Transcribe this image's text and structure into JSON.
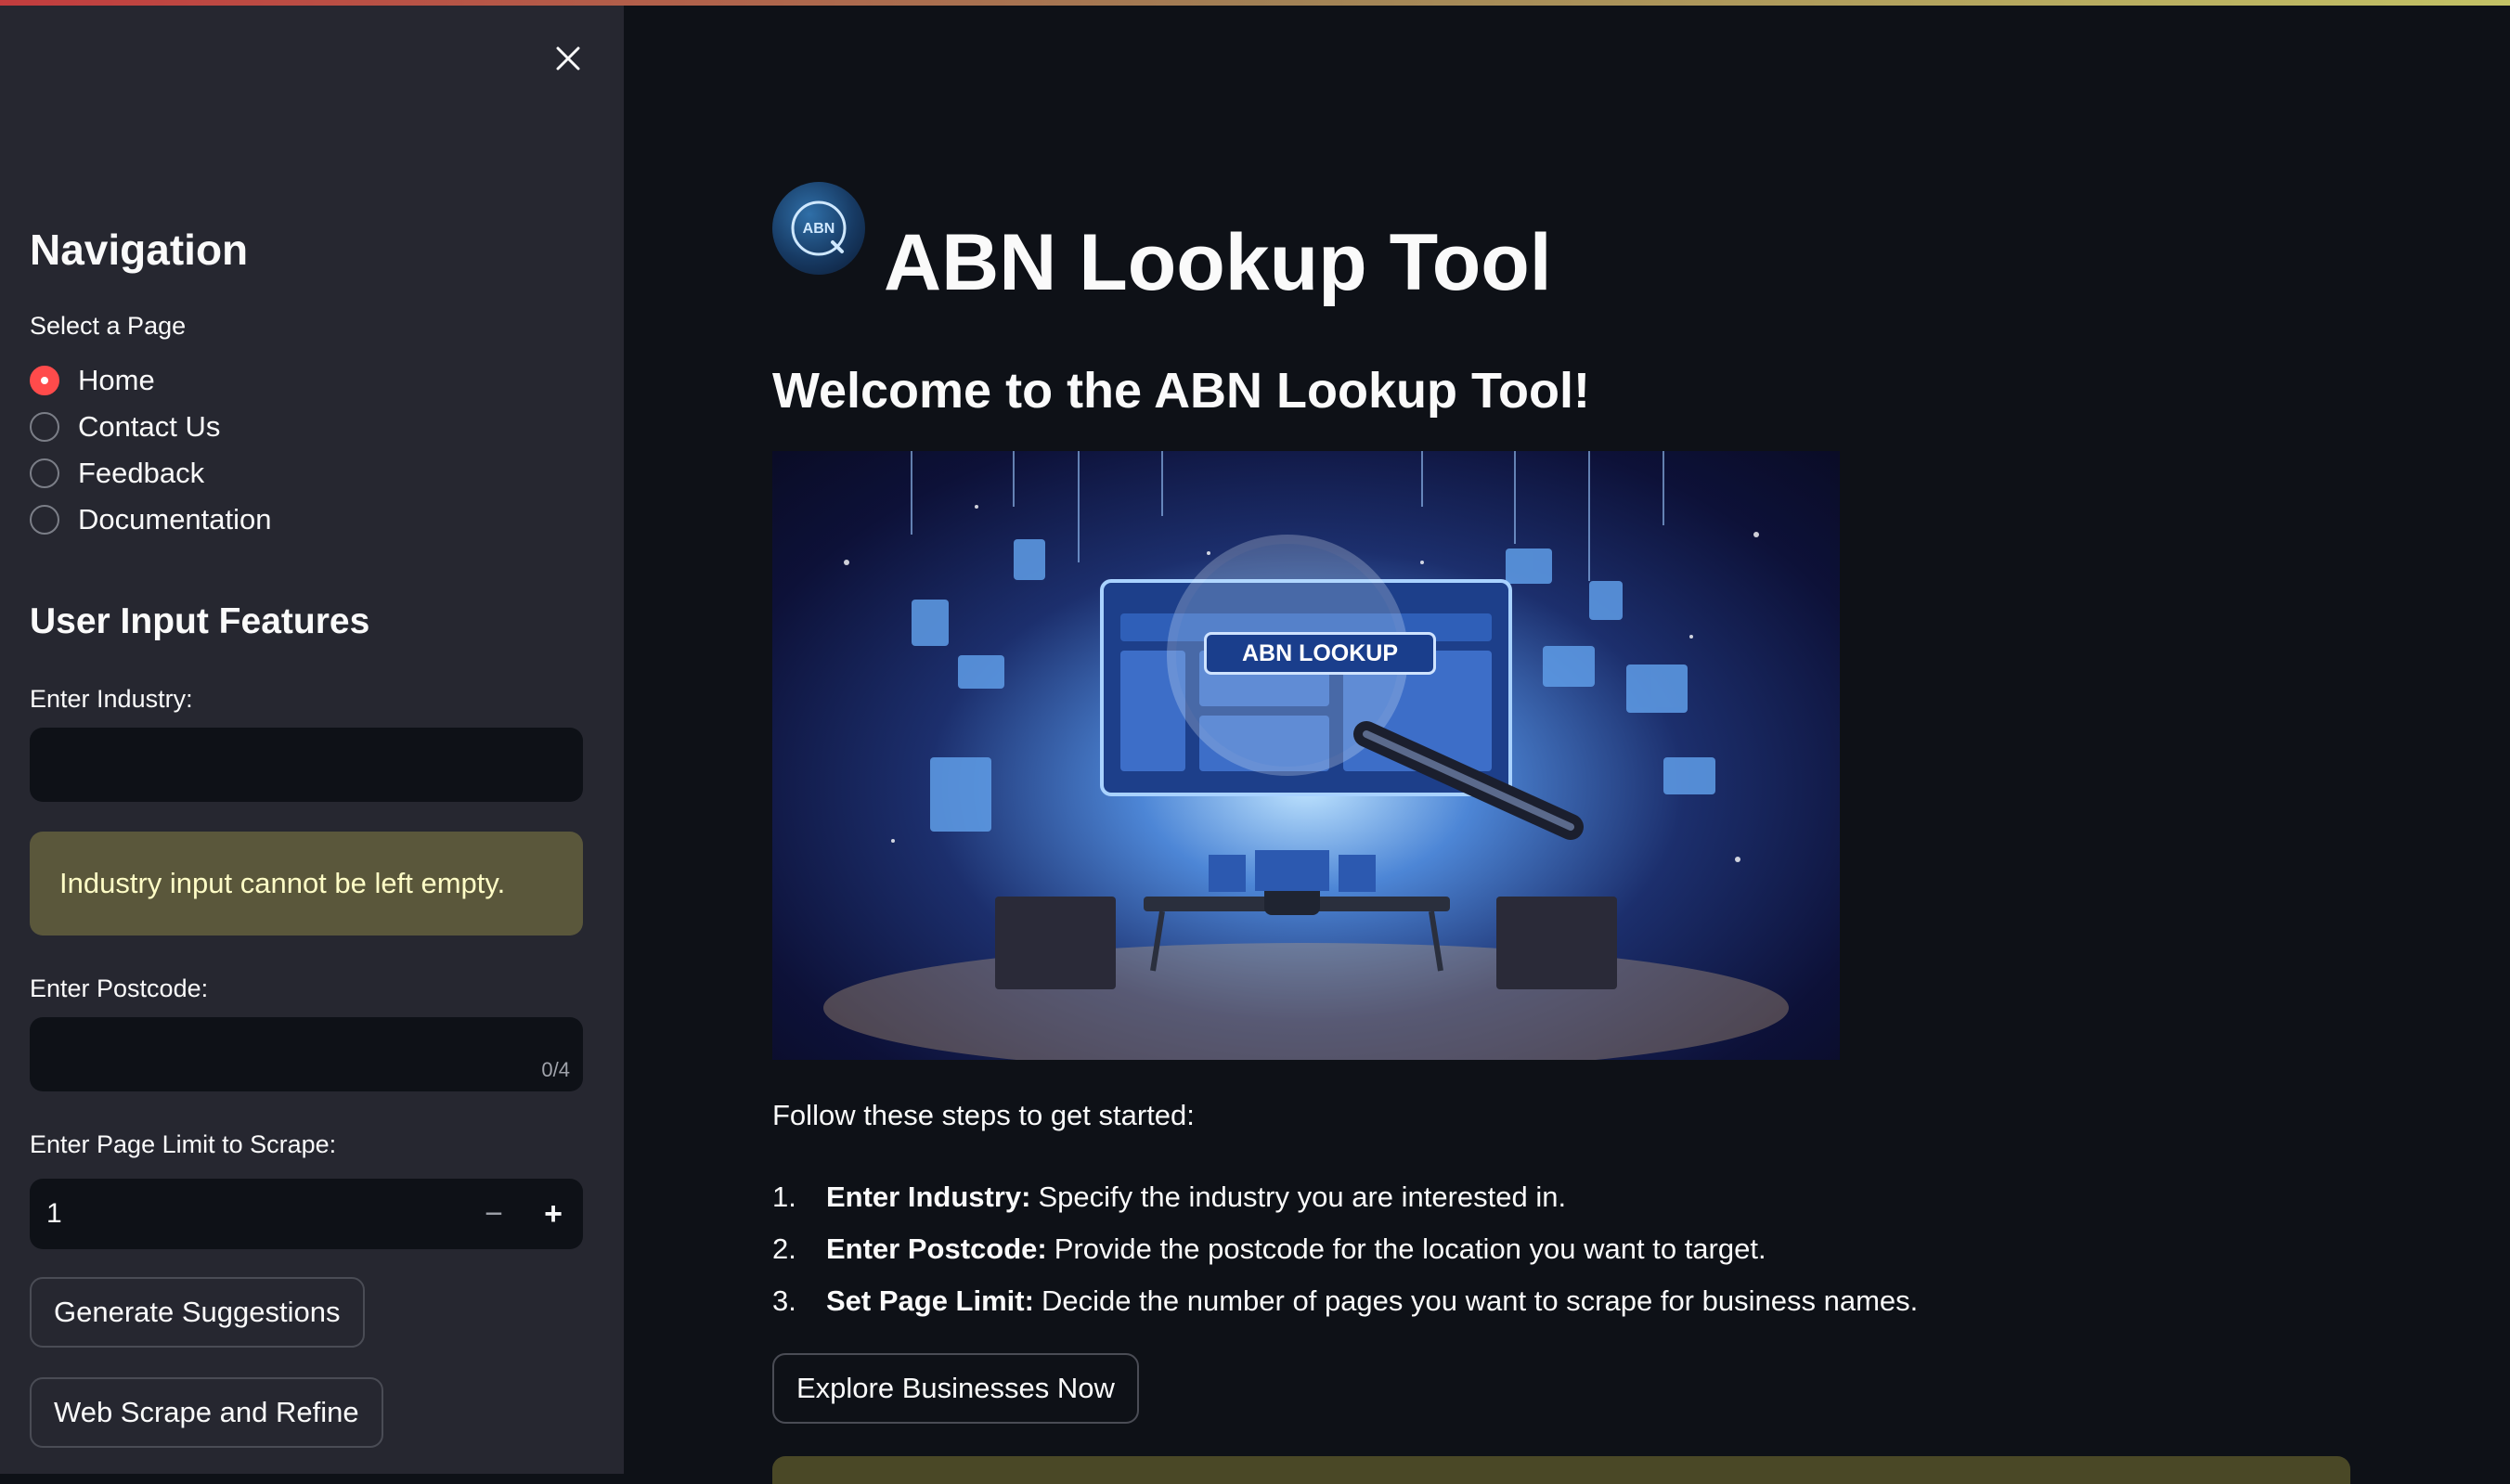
{
  "sidebar": {
    "nav_heading": "Navigation",
    "select_page_label": "Select a Page",
    "pages": [
      {
        "label": "Home",
        "selected": true
      },
      {
        "label": "Contact Us",
        "selected": false
      },
      {
        "label": "Feedback",
        "selected": false
      },
      {
        "label": "Documentation",
        "selected": false
      }
    ],
    "features_heading": "User Input Features",
    "industry_label": "Enter Industry:",
    "industry_value": "",
    "industry_warning": "Industry input cannot be left empty.",
    "postcode_label": "Enter Postcode:",
    "postcode_value": "",
    "postcode_counter": "0/4",
    "page_limit_label": "Enter Page Limit to Scrape:",
    "page_limit_value": "1",
    "minus_symbol": "−",
    "plus_symbol": "+",
    "generate_button": "Generate Suggestions",
    "scrape_button": "Web Scrape and Refine"
  },
  "main": {
    "title": "ABN Lookup Tool",
    "logo_text": "ABN",
    "subtitle": "Welcome to the ABN Lookup Tool!",
    "hero_caption": "ABN LOOKUP",
    "steps_intro": "Follow these steps to get started:",
    "steps": [
      {
        "num": "1.",
        "bold": "Enter Industry:",
        "text": "Specify the industry you are interested in."
      },
      {
        "num": "2.",
        "bold": "Enter Postcode:",
        "text": "Provide the postcode for the location you want to target."
      },
      {
        "num": "3.",
        "bold": "Set Page Limit:",
        "text": "Decide the number of pages you want to scrape for business names."
      }
    ],
    "explore_button": "Explore Businesses Now"
  },
  "colors": {
    "background": "#0e1117",
    "sidebar": "#262730",
    "accent": "#ff4b4b",
    "warning_bg": "#5a573b",
    "warning_text": "#fffdc6"
  },
  "icons": [
    "close-icon",
    "abn-logo-icon",
    "minus-icon",
    "plus-icon"
  ]
}
